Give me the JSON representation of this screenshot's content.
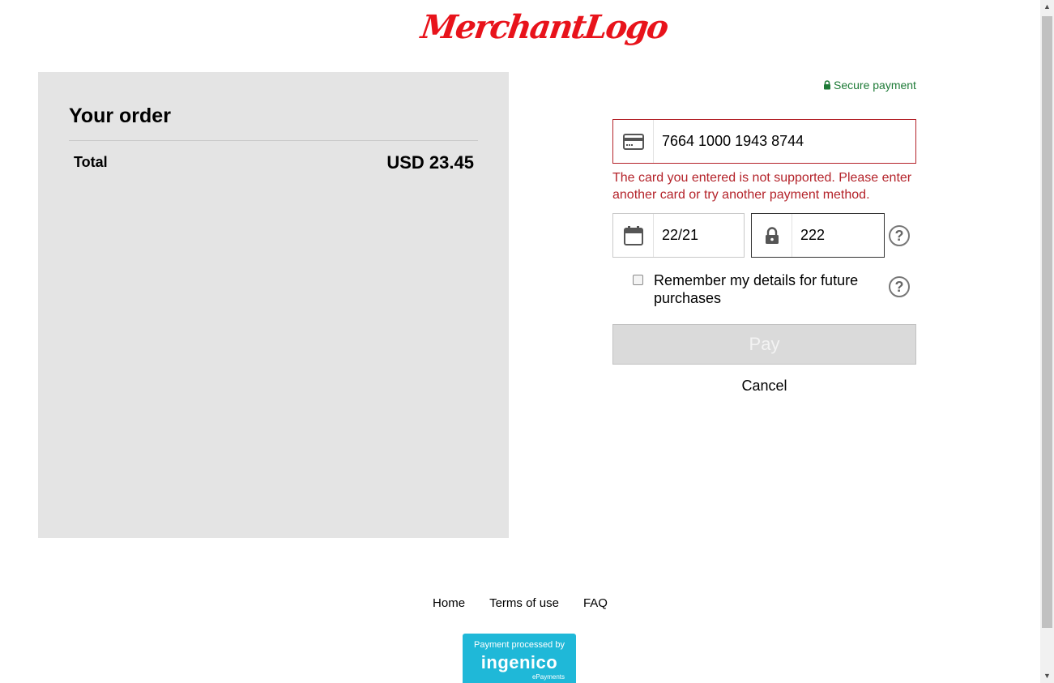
{
  "logo": {
    "text": "MerchantLogo",
    "color": "#e8131b"
  },
  "order": {
    "title": "Your order",
    "total_label": "Total",
    "total_value": "USD 23.45"
  },
  "secure": {
    "label": "Secure payment",
    "icon": "lock-icon",
    "color": "#1d7a36"
  },
  "card": {
    "number": "7664 1000 1943 8744",
    "icon": "credit-card-icon",
    "error": "The card you entered is not supported. Please enter another card or try another payment method.",
    "error_color": "#b4232a"
  },
  "expiry": {
    "value": "22/21",
    "icon": "calendar-icon"
  },
  "cvv": {
    "value": "222",
    "icon": "lock-icon"
  },
  "help_symbol": "?",
  "remember": {
    "label": "Remember my details for future purchases",
    "checked": false
  },
  "pay_button": {
    "label": "Pay",
    "disabled": true
  },
  "cancel": {
    "label": "Cancel"
  },
  "footer": {
    "links": [
      "Home",
      "Terms of use",
      "FAQ"
    ]
  },
  "ingenico": {
    "processed": "Payment processed by",
    "brand": "ingenico",
    "sub": "ePayments",
    "color": "#1fb8d8"
  }
}
